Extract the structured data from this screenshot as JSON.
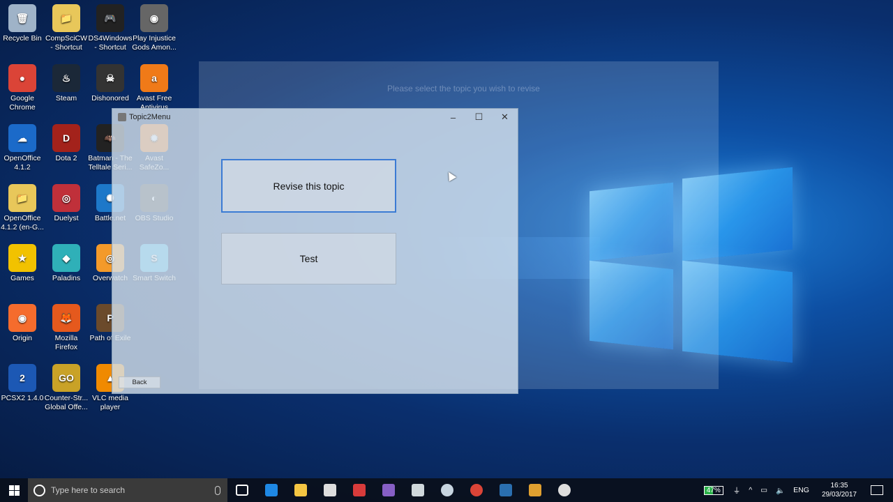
{
  "desktop": {
    "icons": [
      {
        "label": "Recycle Bin",
        "color": "#9fb3c8",
        "glyph": "🗑"
      },
      {
        "label": "CompSciCW - Shortcut",
        "color": "#e8c75a",
        "glyph": "📁"
      },
      {
        "label": "DS4Windows - Shortcut",
        "color": "#222222",
        "glyph": "🎮"
      },
      {
        "label": "Play Injustice Gods Amon...",
        "color": "#666666",
        "glyph": "◉"
      },
      {
        "label": "Google Chrome",
        "color": "#db4437",
        "glyph": "●"
      },
      {
        "label": "Steam",
        "color": "#1b2838",
        "glyph": "♨"
      },
      {
        "label": "Dishonored",
        "color": "#333333",
        "glyph": "☠"
      },
      {
        "label": "Avast Free Antivirus",
        "color": "#f07a18",
        "glyph": "a"
      },
      {
        "label": "OpenOffice 4.1.2",
        "color": "#1b6ac9",
        "glyph": "☁"
      },
      {
        "label": "Dota 2",
        "color": "#a3221b",
        "glyph": "D"
      },
      {
        "label": "Batman - The Telltale Seri...",
        "color": "#222222",
        "glyph": "🦇"
      },
      {
        "label": "Avast SafeZo...",
        "color": "#f07a18",
        "glyph": "✹"
      },
      {
        "label": "OpenOffice 4.1.2 (en-G...",
        "color": "#e8c75a",
        "glyph": "📁"
      },
      {
        "label": "Duelyst",
        "color": "#c0303a",
        "glyph": "◎"
      },
      {
        "label": "Battle.net",
        "color": "#1d78c9",
        "glyph": "✺"
      },
      {
        "label": "OBS Studio",
        "color": "#444444",
        "glyph": "◐"
      },
      {
        "label": "Games",
        "color": "#f2c200",
        "glyph": "★"
      },
      {
        "label": "Paladins",
        "color": "#2fb0b8",
        "glyph": "◆"
      },
      {
        "label": "Overwatch",
        "color": "#f49a2a",
        "glyph": "◎"
      },
      {
        "label": "Smart Switch",
        "color": "#3fb7e8",
        "glyph": "S"
      },
      {
        "label": "Origin",
        "color": "#f56c2d",
        "glyph": "◉"
      },
      {
        "label": "Mozilla Firefox",
        "color": "#e5591d",
        "glyph": "🦊"
      },
      {
        "label": "Path of Exile",
        "color": "#6b4a2b",
        "glyph": "P"
      },
      {
        "label": "PCSX2 1.4.0",
        "color": "#1c58b4",
        "glyph": "2"
      },
      {
        "label": "Counter-Str... Global Offe...",
        "color": "#c9a227",
        "glyph": "GO"
      },
      {
        "label": "VLC media player",
        "color": "#f08a00",
        "glyph": "▲"
      }
    ]
  },
  "ghost_dialog": {
    "text": "Please select the topic you wish to revise"
  },
  "window": {
    "title": "Topic2Menu",
    "minimize": "–",
    "maximize": "☐",
    "close": "✕",
    "revise_button": "Revise this topic",
    "test_button": "Test",
    "back_button": "Back"
  },
  "taskbar": {
    "search_placeholder": "Type here to search",
    "battery": "47%",
    "language": "ENG",
    "time": "16:35",
    "date": "29/03/2017",
    "pinned": [
      {
        "name": "task-view",
        "color": "#ffffff"
      },
      {
        "name": "edge",
        "color": "#1e88e5"
      },
      {
        "name": "file-explorer",
        "color": "#f4c542"
      },
      {
        "name": "store",
        "color": "#dddddd"
      },
      {
        "name": "app-red",
        "color": "#d83b3b"
      },
      {
        "name": "visual-studio",
        "color": "#865fc5"
      },
      {
        "name": "files",
        "color": "#cfd8dc"
      },
      {
        "name": "steam",
        "color": "#c7d5e0"
      },
      {
        "name": "chrome",
        "color": "#db4437"
      },
      {
        "name": "app-blue",
        "color": "#2a6fb0"
      },
      {
        "name": "app-yellow",
        "color": "#e0a030"
      },
      {
        "name": "obs",
        "color": "#dddddd"
      }
    ]
  }
}
